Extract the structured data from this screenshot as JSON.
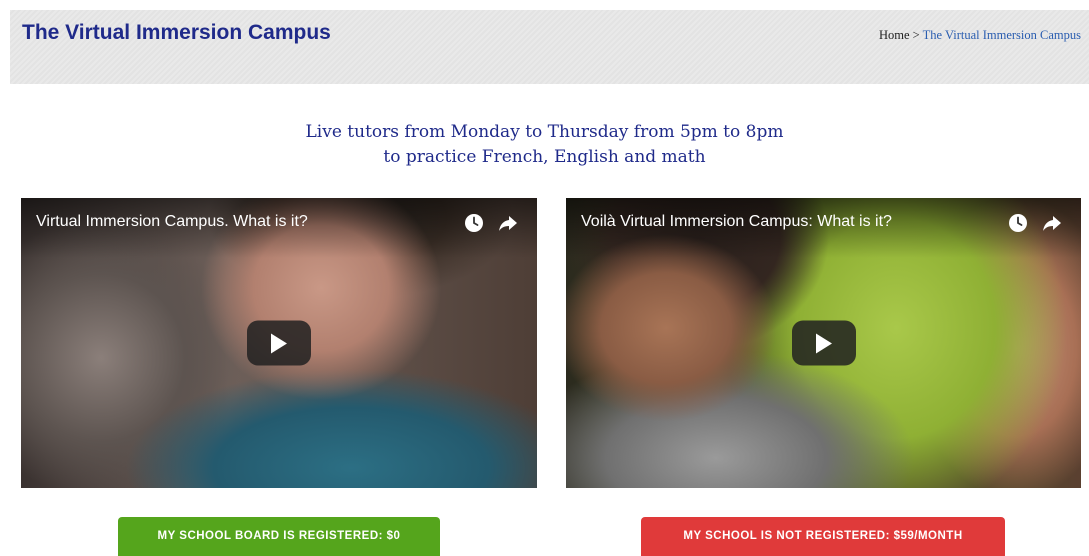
{
  "header": {
    "title": "The Virtual Immersion Campus",
    "breadcrumb": {
      "home": "Home",
      "separator": " > ",
      "current": "The Virtual Immersion Campus"
    }
  },
  "tagline": {
    "line1": "Live tutors from Monday to Thursday from 5pm to 8pm",
    "line2": "to practice French, English and math"
  },
  "videos": [
    {
      "title": "Virtual Immersion Campus. What is it?"
    },
    {
      "title": "Voilà Virtual Immersion Campus: What is it?"
    }
  ],
  "cta": {
    "registered_label": "MY SCHOOL BOARD IS REGISTERED: $0",
    "not_registered_label": "MY SCHOOL IS NOT REGISTERED: $59/MONTH"
  },
  "colors": {
    "brand": "#1f2a8a",
    "link": "#2a5db0",
    "registered": "#55a51c",
    "not_registered": "#e03a3a"
  },
  "icons": [
    "clock-icon",
    "share-icon",
    "play-icon"
  ]
}
